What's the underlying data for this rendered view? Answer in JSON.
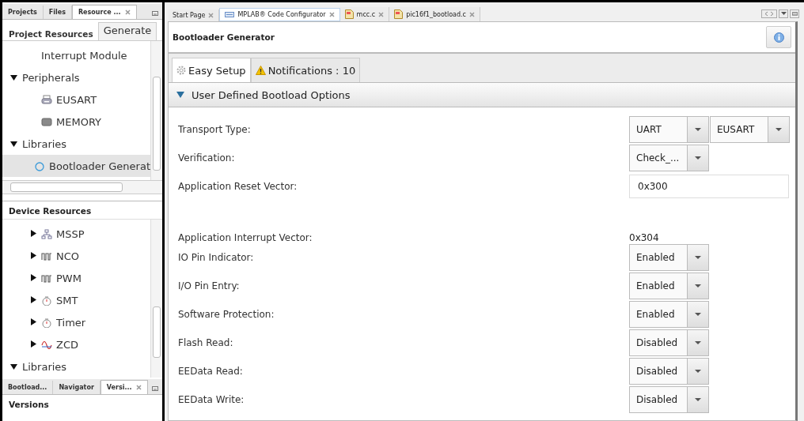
{
  "left_panel": {
    "tabs": [
      {
        "label": "Projects",
        "selected": false,
        "closable": false
      },
      {
        "label": "Files",
        "selected": false,
        "closable": false
      },
      {
        "label": "Resource ...",
        "selected": true,
        "closable": true
      }
    ],
    "subtabs": [
      {
        "label": "Project Resources",
        "selected": true
      },
      {
        "label": "Generate",
        "selected": false
      }
    ],
    "project_tree": [
      {
        "children": [
          {
            "label": "Interrupt Module",
            "selected": false
          }
        ]
      },
      {
        "label": "Peripherals",
        "expanded": true,
        "selected": false,
        "children": [
          {
            "label": "EUSART",
            "kind": "printer",
            "selected": false
          },
          {
            "label": "MEMORY",
            "kind": "chip",
            "selected": false
          }
        ]
      },
      {
        "label": "Libraries",
        "expanded": true,
        "selected": false,
        "children": [
          {
            "label": "Bootloader Generat",
            "kind": "ring",
            "selected": true
          }
        ]
      }
    ],
    "device_title": "Device Resources",
    "device_tree": [
      {
        "children": [
          {
            "label": "MSSP",
            "kind": "network",
            "expanded": false
          },
          {
            "label": "NCO",
            "kind": "pulse",
            "expanded": false
          },
          {
            "label": "PWM",
            "kind": "pulse",
            "expanded": false
          },
          {
            "label": "SMT",
            "kind": "timer",
            "expanded": false
          },
          {
            "label": "Timer",
            "kind": "timer",
            "expanded": false
          },
          {
            "label": "ZCD",
            "kind": "wave",
            "expanded": false
          }
        ]
      },
      {
        "label": "Libraries",
        "expanded": true
      }
    ],
    "bottom_tabs": [
      {
        "label": "Bootload...",
        "selected": false,
        "closable": false
      },
      {
        "label": "Navigator",
        "selected": false,
        "closable": false
      },
      {
        "label": "Versi...",
        "selected": true,
        "closable": true
      }
    ],
    "bottom_title": "Versions"
  },
  "editor_tabs": [
    {
      "label": "Start Page",
      "kind": "plain",
      "selected": false
    },
    {
      "label": "MPLAB® Code Configurator",
      "kind": "mcc",
      "selected": true
    },
    {
      "label": "mcc.c",
      "kind": "file",
      "selected": false
    },
    {
      "label": "pic16f1_bootload.c",
      "kind": "file",
      "selected": false
    }
  ],
  "header": {
    "title": "Bootloader Generator"
  },
  "setup_tabs": [
    {
      "label": "Easy Setup",
      "kind": "gear",
      "selected": true
    },
    {
      "label": "Notifications : 10",
      "kind": "warning",
      "selected": false
    }
  ],
  "section": {
    "title": "User Defined Bootload Options",
    "expanded": true
  },
  "options": [
    {
      "label": "Transport Type:",
      "kind": "combo",
      "values": [
        "UART",
        "EUSART"
      ]
    },
    {
      "label": "Verification:",
      "kind": "combo",
      "values": [
        "Check_..."
      ]
    },
    {
      "label": "Application Reset Vector:",
      "kind": "field",
      "value": "0x300"
    },
    {
      "label": "Application Interrupt Vector:",
      "kind": "text",
      "value": "0x304"
    },
    {
      "label": "IO Pin Indicator:",
      "kind": "combo",
      "values": [
        "Enabled"
      ]
    },
    {
      "label": "I/O Pin Entry:",
      "kind": "combo",
      "values": [
        "Enabled"
      ]
    },
    {
      "label": "Software Protection:",
      "kind": "combo",
      "values": [
        "Enabled"
      ]
    },
    {
      "label": "Flash Read:",
      "kind": "combo",
      "values": [
        "Disabled"
      ]
    },
    {
      "label": "EEData Read:",
      "kind": "combo",
      "values": [
        "Disabled"
      ]
    },
    {
      "label": "EEData Write:",
      "kind": "combo",
      "values": [
        "Disabled"
      ]
    }
  ]
}
